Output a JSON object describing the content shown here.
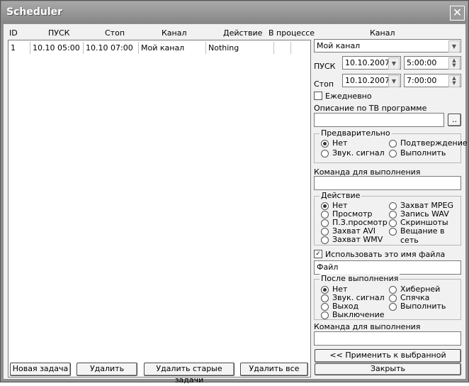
{
  "window": {
    "title": "Scheduler",
    "close_glyph": "✕"
  },
  "table": {
    "headers": [
      "ID",
      "ПУСК",
      "Стоп",
      "Канал",
      "Действие",
      "В процессе"
    ],
    "rows": [
      {
        "id": "1",
        "start": "10.10  05:00",
        "stop": "10.10  07:00",
        "channel": "Мой канал",
        "action": "Nothing",
        "in_progress": ""
      }
    ]
  },
  "buttons": {
    "new_task": "Новая задача",
    "delete": "Удалить",
    "delete_old": "Удалить старые задачи",
    "delete_all": "Удалить все",
    "apply": "<< Применить к выбранной задаче",
    "close": "Закрыть",
    "browse": ".."
  },
  "right": {
    "channel_label": "Канал",
    "channel_value": "Мой канал",
    "start_label": "ПУСК",
    "start_date": "10.10.2007",
    "start_time": "5:00:00",
    "stop_label": "Стоп",
    "stop_date": "10.10.2007",
    "stop_time": "7:00:00",
    "daily_label": "Ежедневно",
    "description_label": "Описание по ТВ программе",
    "description_value": "",
    "pre": {
      "title": "Предварительно",
      "opt_none": "Нет",
      "opt_confirm": "Подтверждение",
      "opt_sound": "Звук. сигнал",
      "opt_execute": "Выполнить"
    },
    "command_label": "Команда для выполнения",
    "command_value": "",
    "action": {
      "title": "Действие",
      "opt_none": "Нет",
      "opt_view": "Просмотр",
      "opt_pview": "П.З.просмотр",
      "opt_avi": "Захват AVI",
      "opt_wmv": "Захват WMV",
      "opt_mpeg": "Захват MPEG",
      "opt_wav": "Запись WAV",
      "opt_screens": "Скриншоты",
      "opt_broadcast": "Вещание в сеть"
    },
    "use_filename_label": "Использовать это имя файла",
    "filename_value": "Файл",
    "after": {
      "title": "После выполнения",
      "opt_none": "Нет",
      "opt_sound": "Звук. сигнал",
      "opt_exit": "Выход",
      "opt_shutdown": "Выключение",
      "opt_hibernate": "Хиберней",
      "opt_sleep": "Спячка",
      "opt_execute": "Выполнить"
    },
    "command2_label": "Команда для выполнения",
    "command2_value": ""
  }
}
